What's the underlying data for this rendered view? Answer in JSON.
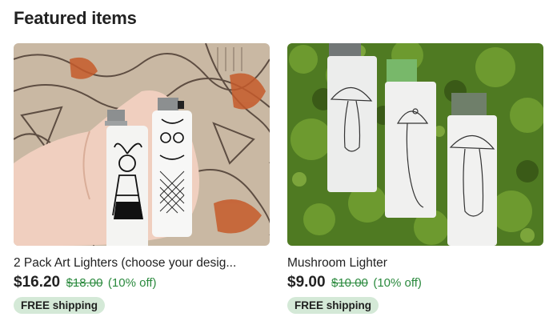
{
  "section": {
    "title": "Featured items"
  },
  "items": [
    {
      "title": "2 Pack Art Lighters (choose your desig...",
      "price": "$16.20",
      "original_price": "$18.00",
      "discount": "(10% off)",
      "badge": "FREE shipping"
    },
    {
      "title": "Mushroom Lighter",
      "price": "$9.00",
      "original_price": "$10.00",
      "discount": "(10% off)",
      "badge": "FREE shipping"
    }
  ],
  "colors": {
    "sale_green": "#2b8a3e",
    "badge_bg": "#d4e9d7",
    "text": "#222222"
  }
}
